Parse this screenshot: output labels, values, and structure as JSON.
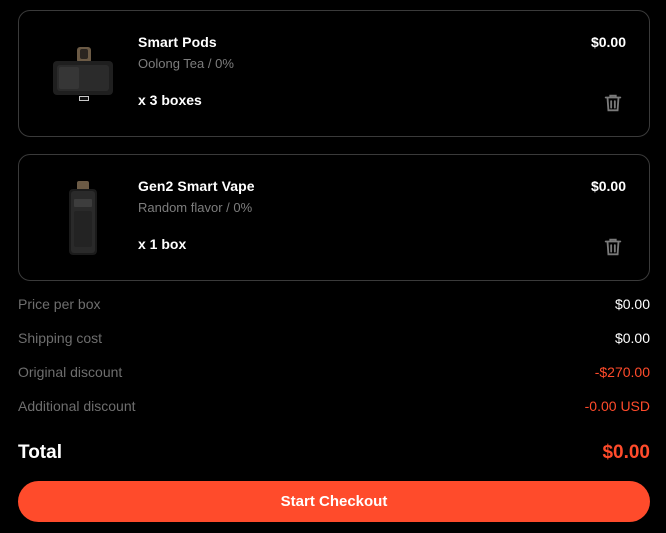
{
  "cart": {
    "items": [
      {
        "name": "Smart Pods",
        "variant": "Oolong Tea / 0%",
        "quantity": "x 3 boxes",
        "price": "$0.00",
        "icon": "pod-cartridge-image"
      },
      {
        "name": "Gen2 Smart Vape",
        "variant": "Random flavor / 0%",
        "quantity": "x 1 box",
        "price": "$0.00",
        "icon": "vape-device-image"
      }
    ]
  },
  "summary": {
    "price_per_box_label": "Price per box",
    "price_per_box_value": "$0.00",
    "shipping_label": "Shipping cost",
    "shipping_value": "$0.00",
    "original_discount_label": "Original discount",
    "original_discount_value": "-$270.00",
    "additional_discount_label": "Additional discount",
    "additional_discount_value": "-0.00 USD"
  },
  "total": {
    "label": "Total",
    "value": "$0.00"
  },
  "checkout": {
    "label": "Start Checkout"
  },
  "colors": {
    "accent": "#ff4b2b",
    "background": "#000000",
    "muted_text": "#6e6e6e",
    "card_border": "#3a3a3a"
  }
}
